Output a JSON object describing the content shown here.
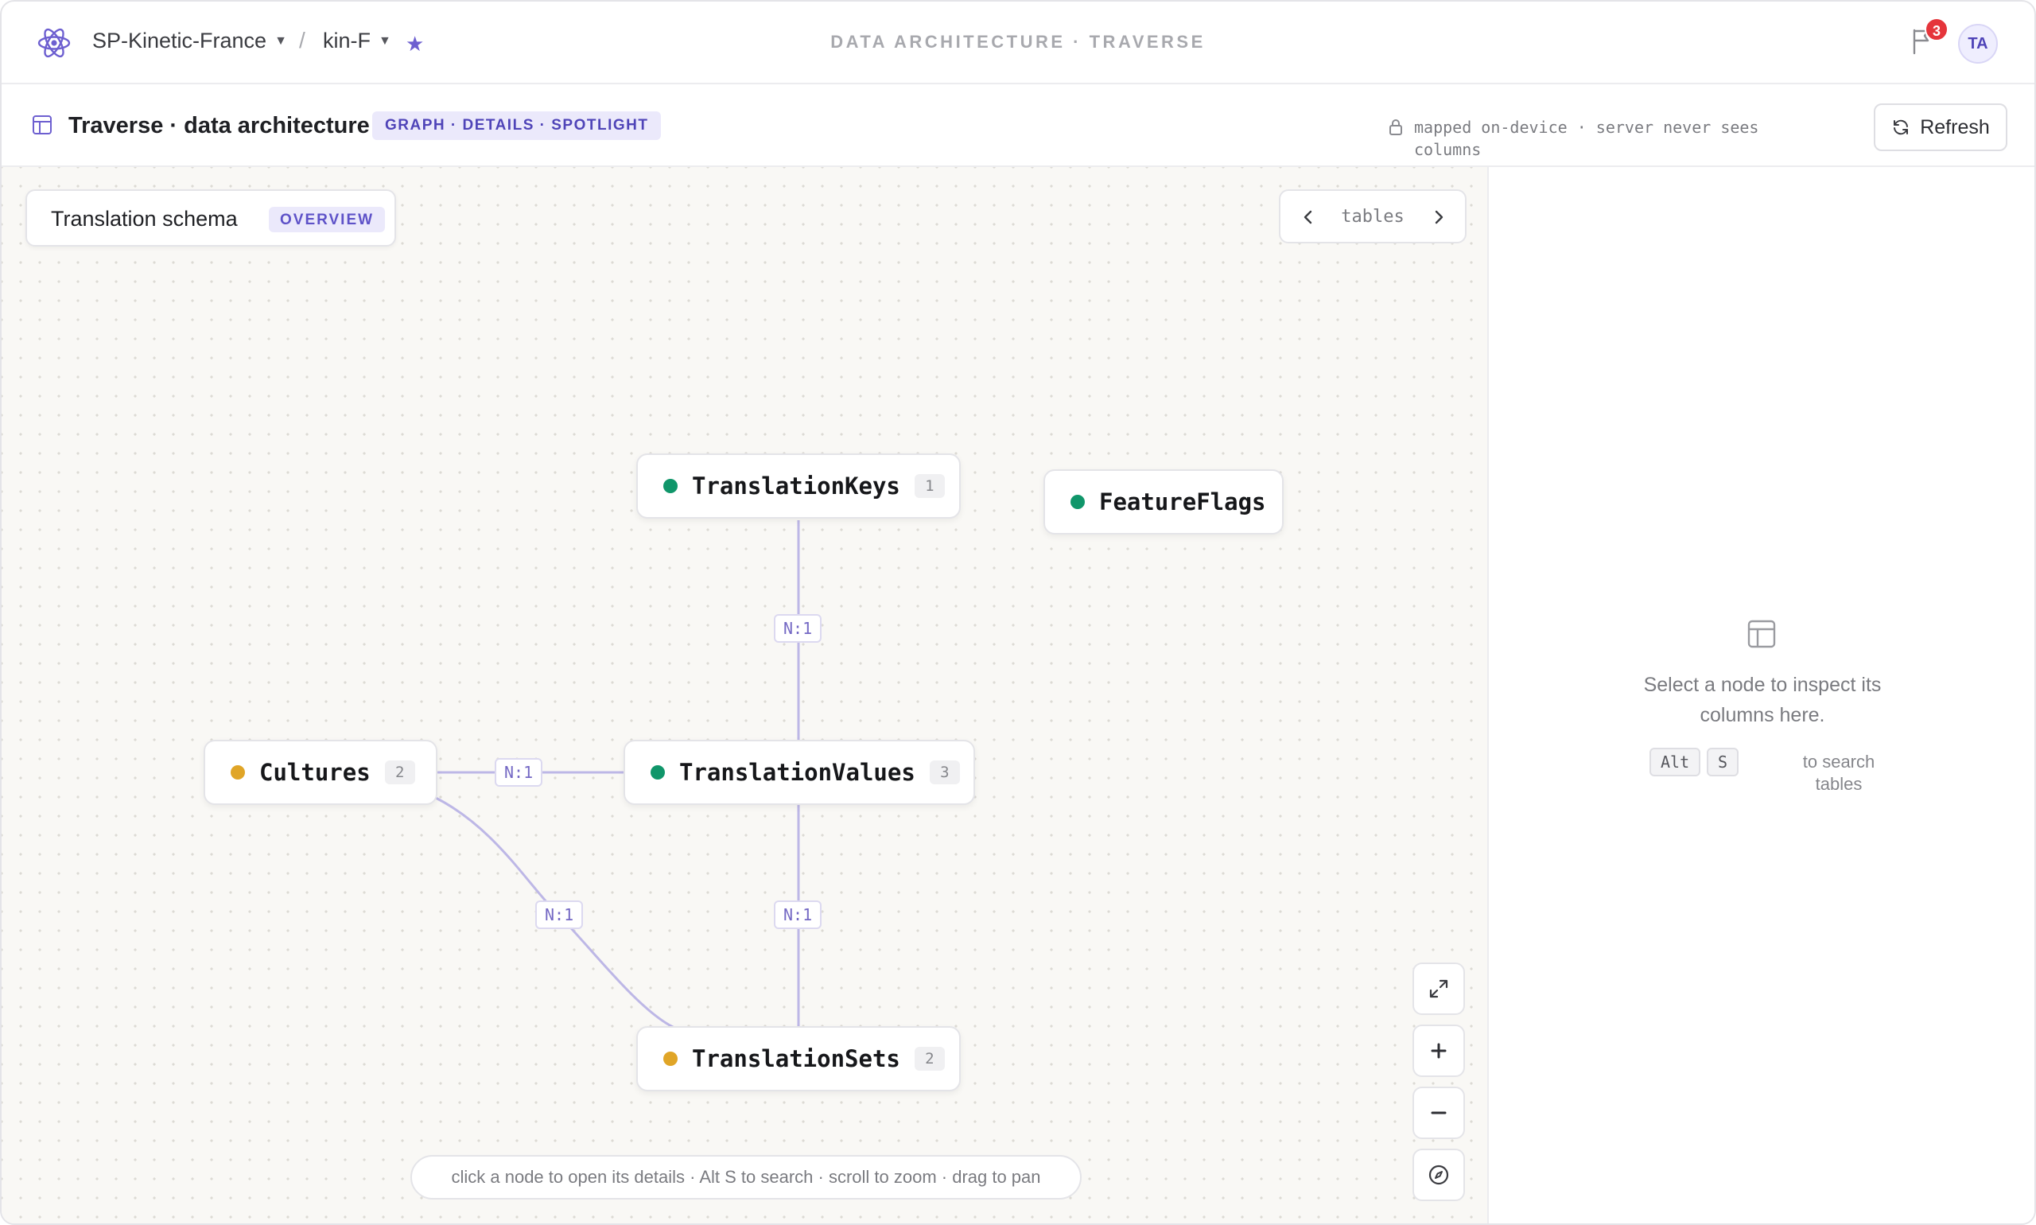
{
  "topbar": {
    "org": "SP-Kinetic-France",
    "project": "kin-F",
    "separator": "/",
    "title": "DATA ARCHITECTURE · TRAVERSE",
    "notification_count": "3",
    "avatar_initials": "TA"
  },
  "subbar": {
    "title": "Traverse · data architecture",
    "mode": "GRAPH · DETAILS · SPOTLIGHT",
    "privacy_note": "mapped on-device · server never sees columns",
    "refresh_label": "Refresh"
  },
  "canvas": {
    "schema_title": "Translation schema",
    "schema_badge": "OVERVIEW",
    "pager_label": "tables",
    "hint": "click a node to open its details · Alt S to search · scroll to zoom · drag to pan",
    "nodes": [
      {
        "name": "TranslationKeys",
        "count": "1",
        "status_color": "#10966a"
      },
      {
        "name": "FeatureFlags",
        "count": "",
        "status_color": "#10966a"
      },
      {
        "name": "Cultures",
        "count": "2",
        "status_color": "#e0a527"
      },
      {
        "name": "TranslationValues",
        "count": "3",
        "status_color": "#10966a"
      },
      {
        "name": "TranslationSets",
        "count": "2",
        "status_color": "#e0a527"
      }
    ],
    "edges": [
      {
        "from": "TranslationValues",
        "to": "TranslationKeys",
        "label": "N:1"
      },
      {
        "from": "TranslationValues",
        "to": "Cultures",
        "label": "N:1"
      },
      {
        "from": "TranslationSets",
        "to": "Cultures",
        "label": "N:1"
      },
      {
        "from": "TranslationValues",
        "to": "TranslationSets",
        "label": "N:1"
      }
    ],
    "controls": [
      "expand-icon",
      "zoom-in-icon",
      "zoom-out-icon",
      "compass-icon"
    ]
  },
  "panel": {
    "empty_text": "Select a node to inspect its columns here.",
    "key1": "Alt",
    "key2": "S",
    "key_hint": "to search tables"
  },
  "colors": {
    "accent": "#5e52c8",
    "edge": "#bdb7e6",
    "notification": "#e5353b"
  }
}
